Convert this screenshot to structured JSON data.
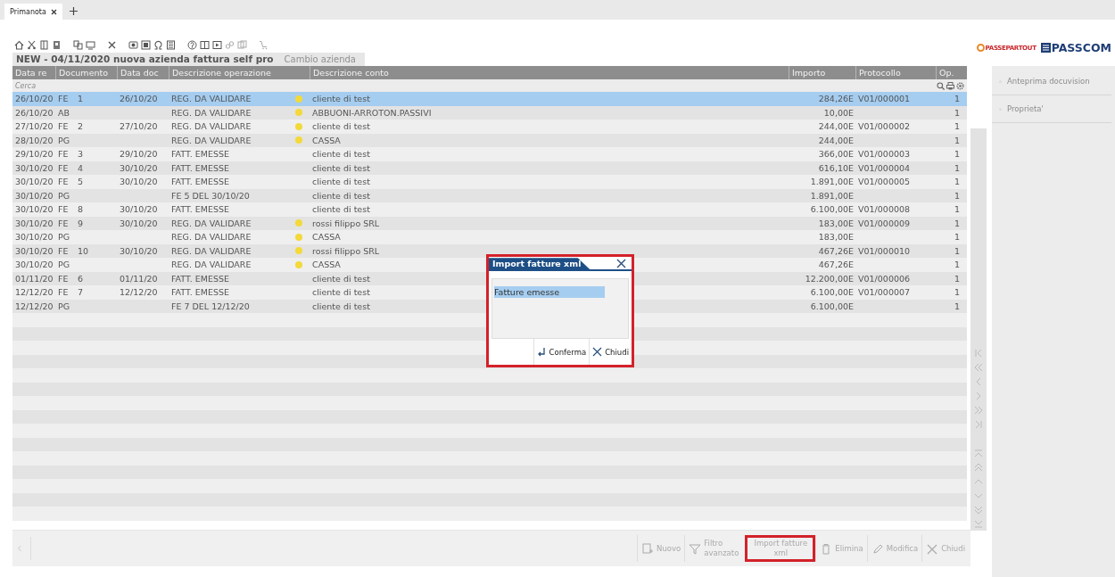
{
  "tabs": [
    {
      "label": "Primanota",
      "selected": true
    }
  ],
  "logo": {
    "brand": "PASSEPARTOUT",
    "product": "PASSCOM"
  },
  "title": "NEW - 04/11/2020  nuova azienda fattura self pro",
  "company_button": {
    "label": "Cambio azienda",
    "disabled": true
  },
  "table": {
    "columns": [
      "Data re",
      "Documento",
      "Data doc",
      "Descrizione operazione",
      "Descrizione conto",
      "Importo",
      "Protocollo",
      "Op."
    ],
    "search": {
      "placeholder": "Cerca"
    },
    "rows": [
      {
        "date": "26/10/20",
        "doc_type": "FE",
        "doc_number": "1",
        "doc_date": "26/10/20",
        "operation": "REG. DA VALIDARE",
        "flagged": true,
        "account": "cliente di test",
        "amount": "284,26E",
        "protocol": "V01/000001",
        "op": "1",
        "selected": true
      },
      {
        "date": "26/10/20",
        "doc_type": "AB",
        "doc_number": "",
        "doc_date": "",
        "operation": "REG. DA VALIDARE",
        "flagged": true,
        "account": "ABBUONI-ARROTON.PASSIVI",
        "amount": "10,00E",
        "protocol": "",
        "op": "1",
        "selected": false
      },
      {
        "date": "27/10/20",
        "doc_type": "FE",
        "doc_number": "2",
        "doc_date": "27/10/20",
        "operation": "REG. DA VALIDARE",
        "flagged": true,
        "account": "cliente di test",
        "amount": "244,00E",
        "protocol": "V01/000002",
        "op": "1",
        "selected": false
      },
      {
        "date": "28/10/20",
        "doc_type": "PG",
        "doc_number": "",
        "doc_date": "",
        "operation": "REG. DA VALIDARE",
        "flagged": true,
        "account": "CASSA",
        "amount": "244,00E",
        "protocol": "",
        "op": "1",
        "selected": false
      },
      {
        "date": "29/10/20",
        "doc_type": "FE",
        "doc_number": "3",
        "doc_date": "29/10/20",
        "operation": "FATT. EMESSE",
        "flagged": false,
        "account": "cliente di test",
        "amount": "366,00E",
        "protocol": "V01/000003",
        "op": "1",
        "selected": false
      },
      {
        "date": "30/10/20",
        "doc_type": "FE",
        "doc_number": "4",
        "doc_date": "30/10/20",
        "operation": "FATT. EMESSE",
        "flagged": false,
        "account": "cliente di test",
        "amount": "616,10E",
        "protocol": "V01/000004",
        "op": "1",
        "selected": false
      },
      {
        "date": "30/10/20",
        "doc_type": "FE",
        "doc_number": "5",
        "doc_date": "30/10/20",
        "operation": "FATT. EMESSE",
        "flagged": false,
        "account": "cliente di test",
        "amount": "1.891,00E",
        "protocol": "V01/000005",
        "op": "1",
        "selected": false
      },
      {
        "date": "30/10/20",
        "doc_type": "PG",
        "doc_number": "",
        "doc_date": "",
        "operation": "FE 5 DEL 30/10/20",
        "flagged": false,
        "account": "cliente di test",
        "amount": "1.891,00E",
        "protocol": "",
        "op": "1",
        "selected": false
      },
      {
        "date": "30/10/20",
        "doc_type": "FE",
        "doc_number": "8",
        "doc_date": "30/10/20",
        "operation": "FATT. EMESSE",
        "flagged": false,
        "account": "cliente di test",
        "amount": "6.100,00E",
        "protocol": "V01/000008",
        "op": "1",
        "selected": false
      },
      {
        "date": "30/10/20",
        "doc_type": "FE",
        "doc_number": "9",
        "doc_date": "30/10/20",
        "operation": "REG. DA VALIDARE",
        "flagged": true,
        "account": "rossi filippo SRL",
        "amount": "183,00E",
        "protocol": "V01/000009",
        "op": "1",
        "selected": false
      },
      {
        "date": "30/10/20",
        "doc_type": "PG",
        "doc_number": "",
        "doc_date": "",
        "operation": "REG. DA VALIDARE",
        "flagged": true,
        "account": "CASSA",
        "amount": "183,00E",
        "protocol": "",
        "op": "1",
        "selected": false
      },
      {
        "date": "30/10/20",
        "doc_type": "FE",
        "doc_number": "10",
        "doc_date": "30/10/20",
        "operation": "REG. DA VALIDARE",
        "flagged": true,
        "account": "rossi filippo SRL",
        "amount": "467,26E",
        "protocol": "V01/000010",
        "op": "1",
        "selected": false
      },
      {
        "date": "30/10/20",
        "doc_type": "PG",
        "doc_number": "",
        "doc_date": "",
        "operation": "REG. DA VALIDARE",
        "flagged": true,
        "account": "CASSA",
        "amount": "467,26E",
        "protocol": "",
        "op": "1",
        "selected": false
      },
      {
        "date": "01/11/20",
        "doc_type": "FE",
        "doc_number": "6",
        "doc_date": "01/11/20",
        "operation": "FATT. EMESSE",
        "flagged": false,
        "account": "cliente di test",
        "amount": "12.200,00E",
        "protocol": "V01/000006",
        "op": "1",
        "selected": false
      },
      {
        "date": "12/12/20",
        "doc_type": "FE",
        "doc_number": "7",
        "doc_date": "12/12/20",
        "operation": "FATT. EMESSE",
        "flagged": false,
        "account": "cliente di test",
        "amount": "6.100,00E",
        "protocol": "V01/000007",
        "op": "1",
        "selected": false
      },
      {
        "date": "12/12/20",
        "doc_type": "PG",
        "doc_number": "",
        "doc_date": "",
        "operation": "FE 7 DEL 12/12/20",
        "flagged": false,
        "account": "cliente di test",
        "amount": "6.100,00E",
        "protocol": "",
        "op": "1",
        "selected": false
      }
    ]
  },
  "side_panel": [
    {
      "label": "Anteprima docuvision",
      "disabled": true
    },
    {
      "label": "Proprieta'",
      "disabled": true
    }
  ],
  "bottom_buttons": [
    {
      "kind": "new",
      "label": "Nuovo",
      "highlighted": false
    },
    {
      "kind": "filter",
      "label": "Filtro avanzato",
      "highlighted": false
    },
    {
      "kind": "import",
      "label": "Import fatture xml",
      "highlighted": true
    },
    {
      "kind": "delete",
      "label": "Elimina",
      "highlighted": false
    },
    {
      "kind": "edit",
      "label": "Modifica",
      "highlighted": false
    },
    {
      "kind": "close",
      "label": "Chiudi",
      "highlighted": false
    }
  ],
  "dialog": {
    "title": "Import fatture xml",
    "highlighted": true,
    "items": [
      {
        "label": "Fatture emesse",
        "selected": true
      }
    ],
    "buttons": [
      {
        "kind": "confirm",
        "label": "Conferma"
      },
      {
        "kind": "close",
        "label": "Chiudi"
      }
    ]
  }
}
